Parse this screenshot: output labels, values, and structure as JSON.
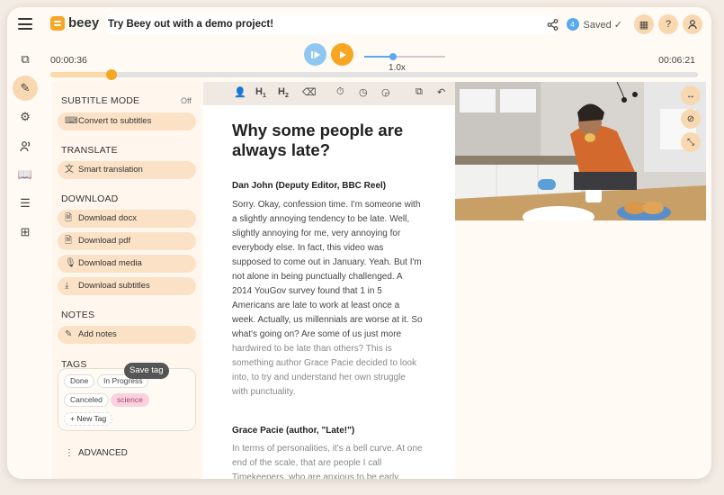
{
  "header": {
    "logo_text": "beey",
    "project_title": "Try Beey out with a demo project!",
    "saved_count": "4",
    "saved_label": "Saved ✓"
  },
  "player": {
    "current_time": "00:00:36",
    "total_time": "00:06:21",
    "speed_label": "1.0x",
    "speed_level": 0.35,
    "progress": 0.094
  },
  "panel": {
    "subtitle_mode": {
      "title": "SUBTITLE MODE",
      "state": "Off",
      "button": "Convert to subtitles"
    },
    "translate": {
      "title": "TRANSLATE",
      "button": "Smart translation"
    },
    "download": {
      "title": "DOWNLOAD",
      "items": [
        "Download docx",
        "Download pdf",
        "Download media",
        "Download subtitles"
      ]
    },
    "notes": {
      "title": "NOTES",
      "button": "Add notes"
    },
    "tags": {
      "title": "TAGS",
      "tooltip": "Save tag",
      "items": [
        "Done",
        "In Progress",
        "Canceled",
        "science"
      ],
      "new_tag": "+ New Tag"
    },
    "advanced": "ADVANCED"
  },
  "editor": {
    "heading": "Why some people are always late?",
    "speaker1": "Dan John (Deputy Editor, BBC Reel)",
    "p1": "Sorry. Okay, confession time. I'm someone with a slightly annoying tendency to be late. Well, slightly annoying for me, very annoying for everybody else. In fact, this video was supposed to come out in January. Yeah. But I'm not alone in being punctually challenged. A 2014 YouGov survey found that 1 in 5 Americans are late to work at least once a week. Actually, us millennials are worse at it. So what's going on? Are some of us just more",
    "p1_gray": "hardwired to be late than others? This is something author Grace Pacie decided to look into, to try and understand her own struggle with punctuality.",
    "speaker2": "Grace Pacie (author, \"Late!\")",
    "p2": "In terms of personalities, it's a bell curve. At one end of the scale, that are people I call Timekeepers, who are anxious to be early,"
  }
}
